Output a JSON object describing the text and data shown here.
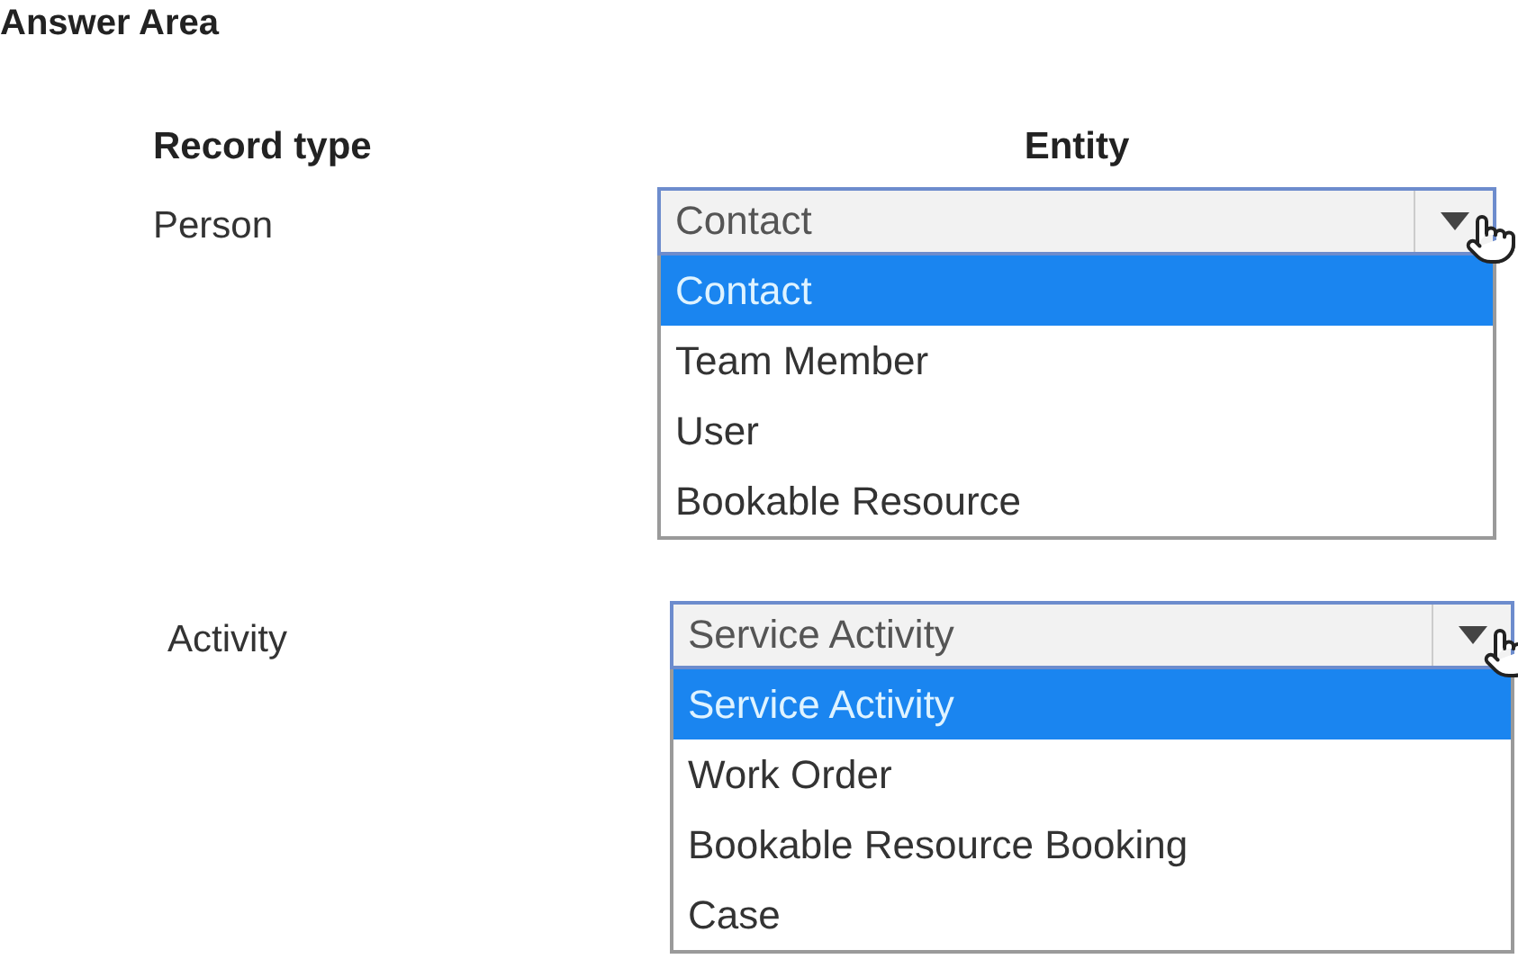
{
  "title": "Answer Area",
  "columns": [
    "Record type",
    "Entity"
  ],
  "rows": [
    {
      "record_type": "Person",
      "dropdown": {
        "value": "Contact",
        "expanded": true,
        "options": [
          {
            "label": "Contact",
            "selected": true
          },
          {
            "label": "Team Member",
            "selected": false
          },
          {
            "label": "User",
            "selected": false
          },
          {
            "label": "Bookable Resource",
            "selected": false
          }
        ]
      }
    },
    {
      "record_type": "Activity",
      "dropdown": {
        "value": "Service Activity",
        "expanded": true,
        "options": [
          {
            "label": "Service Activity",
            "selected": true
          },
          {
            "label": "Work Order",
            "selected": false
          },
          {
            "label": "Bookable Resource Booking",
            "selected": false
          },
          {
            "label": "Case",
            "selected": false
          }
        ]
      }
    }
  ]
}
